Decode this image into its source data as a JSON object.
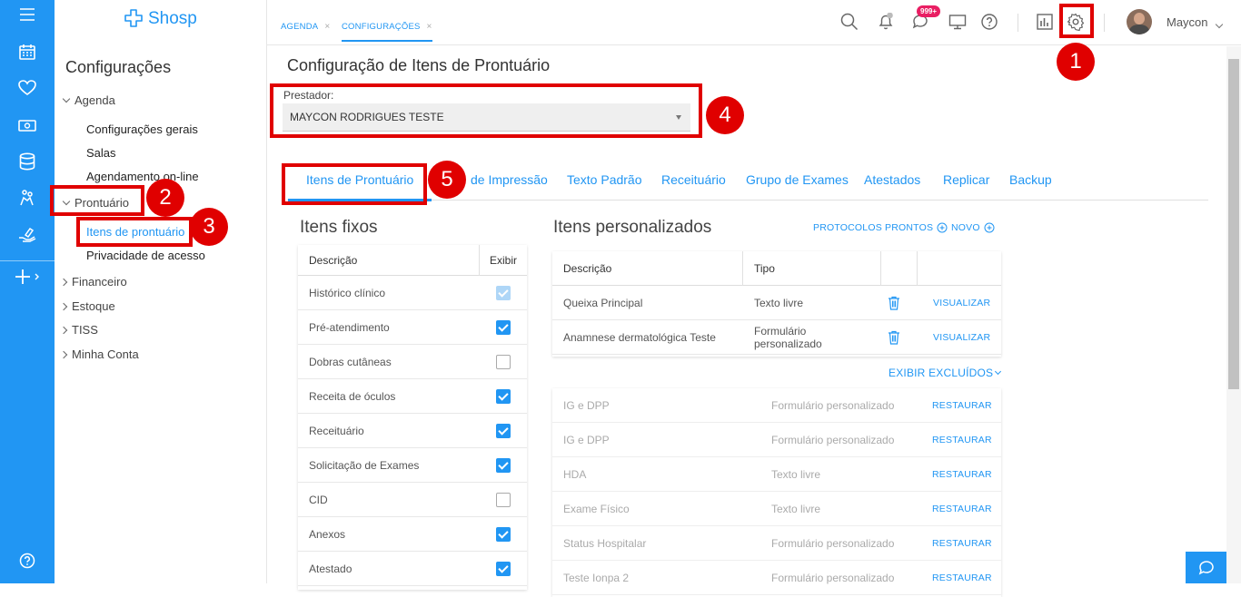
{
  "app": {
    "brand": "Shosp"
  },
  "tabs": [
    {
      "label": "AGENDA",
      "close": "×"
    },
    {
      "label": "CONFIGURAÇÕES",
      "close": "×"
    }
  ],
  "topbar": {
    "notif_badge": "999+",
    "user_name": "Maycon"
  },
  "sidebar": {
    "title": "Configurações",
    "sections": [
      {
        "label": "Agenda",
        "children": [
          "Configurações gerais",
          "Salas",
          "Agendamento on-line"
        ]
      },
      {
        "label": "Prontuário",
        "children": [
          "Itens de prontuário",
          "Privacidade de acesso"
        ]
      },
      {
        "label": "Financeiro"
      },
      {
        "label": "Estoque"
      },
      {
        "label": "TISS"
      },
      {
        "label": "Minha Conta"
      }
    ]
  },
  "main": {
    "title": "Configuração de Itens de Prontuário",
    "provider_label": "Prestador:",
    "provider_value": "MAYCON RODRIGUES TESTE",
    "tabs": [
      "Itens de Prontuário",
      "de Impressão",
      "Texto Padrão",
      "Receituário",
      "Grupo de Exames",
      "Atestados",
      "Replicar",
      "Backup"
    ]
  },
  "fixed": {
    "heading": "Itens fixos",
    "col_desc": "Descrição",
    "col_show": "Exibir",
    "rows": [
      {
        "label": "Histórico clínico",
        "state": "disabled-checked"
      },
      {
        "label": "Pré-atendimento",
        "state": "checked"
      },
      {
        "label": "Dobras cutâneas",
        "state": "unchecked"
      },
      {
        "label": "Receita de óculos",
        "state": "checked"
      },
      {
        "label": "Receituário",
        "state": "checked"
      },
      {
        "label": "Solicitação de Exames",
        "state": "checked"
      },
      {
        "label": "CID",
        "state": "unchecked"
      },
      {
        "label": "Anexos",
        "state": "checked"
      },
      {
        "label": "Atestado",
        "state": "checked"
      }
    ]
  },
  "custom": {
    "heading": "Itens personalizados",
    "protocols_link": "PROTOCOLOS PRONTOS",
    "new_link": "NOVO",
    "col_desc": "Descrição",
    "col_type": "Tipo",
    "rows": [
      {
        "desc": "Queixa Principal",
        "type": "Texto livre",
        "action": "VISUALIZAR"
      },
      {
        "desc": "Anamnese dermatológica Teste",
        "type": "Formulário personalizado",
        "action": "VISUALIZAR"
      }
    ],
    "show_excluded": "EXIBIR EXCLUÍDOS",
    "excluded": [
      {
        "desc": "IG e DPP",
        "type": "Formulário personalizado",
        "action": "RESTAURAR"
      },
      {
        "desc": "IG e DPP",
        "type": "Formulário personalizado",
        "action": "RESTAURAR"
      },
      {
        "desc": "HDA",
        "type": "Texto livre",
        "action": "RESTAURAR"
      },
      {
        "desc": "Exame Físico",
        "type": "Texto livre",
        "action": "RESTAURAR"
      },
      {
        "desc": "Status Hospitalar",
        "type": "Formulário personalizado",
        "action": "RESTAURAR"
      },
      {
        "desc": "Teste Ionpa 2",
        "type": "Formulário personalizado",
        "action": "RESTAURAR"
      }
    ]
  },
  "annotations": [
    "1",
    "2",
    "3",
    "4",
    "5"
  ],
  "colors": {
    "accent": "#2196f3",
    "annotation": "#e00000"
  }
}
